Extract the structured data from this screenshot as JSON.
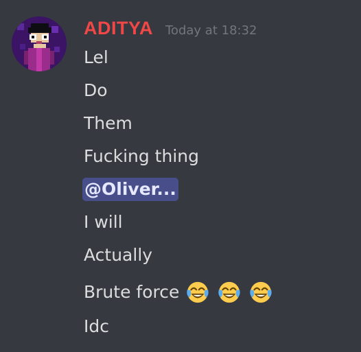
{
  "message": {
    "author": "ADITYA",
    "author_color": "#f04747",
    "timestamp": "Today at 18:32",
    "avatar_icon": "pixel-art-avatar",
    "lines": [
      "Lel",
      "Do",
      "Them",
      "Fucking thing",
      "@Oliver...",
      "I will",
      "Actually",
      "Brute force",
      "Idc"
    ],
    "emojis": [
      "joy-emoji",
      "joy-emoji",
      "joy-emoji"
    ]
  },
  "colors": {
    "background": "#36393f",
    "text": "#dcddde",
    "timestamp": "#72767d",
    "mention_bg": "#474e8a"
  }
}
